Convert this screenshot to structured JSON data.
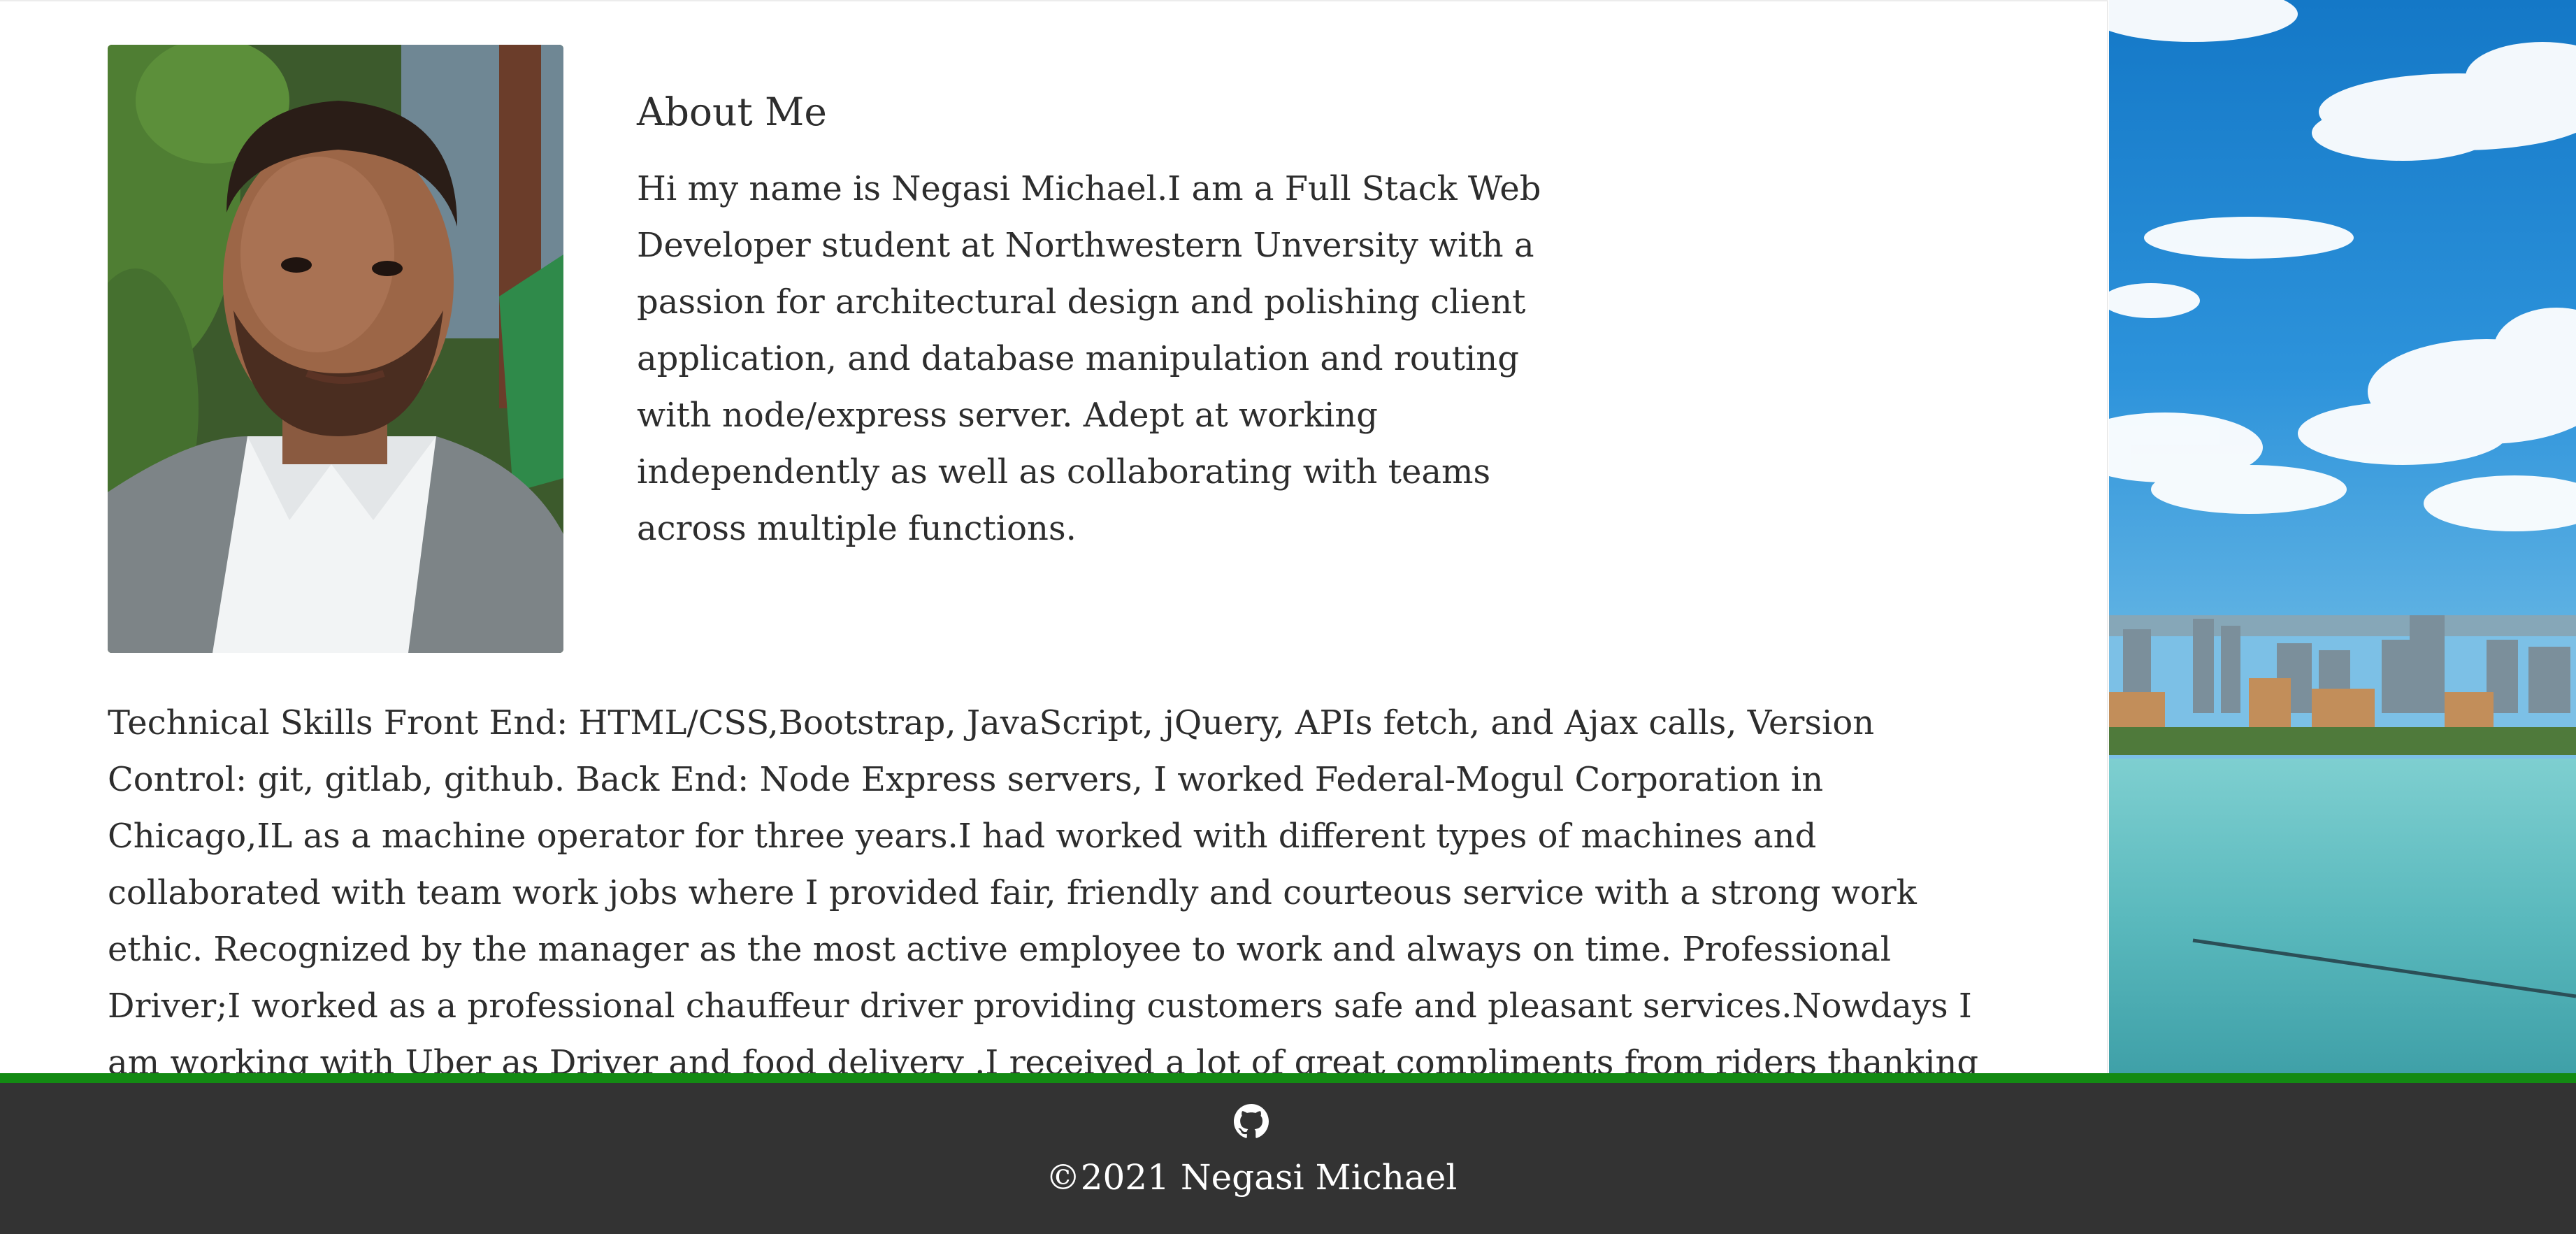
{
  "about": {
    "title": "About Me",
    "body": "Hi my name is Negasi Michael.I am a Full Stack Web Developer student at Northwestern Unversity with a passion for architectural design and polishing client application, and database manipulation and routing with node/express server. Adept at working independently as well as collaborating with teams across multiple functions."
  },
  "skills": {
    "body": "Technical Skills Front End: HTML/CSS,Bootstrap, JavaScript, jQuery, APIs fetch, and Ajax calls, Version Control: git, gitlab, github. Back End: Node Express servers, I worked Federal-Mogul Corporation in Chicago,IL as a machine operator for three years.I had worked with different types of machines and collaborated with team work jobs where I provided fair, friendly and courteous service with a strong work ethic. Recognized by the manager as the most active employee to work and always on time. Professional Driver;I worked as a professional chauffeur driver providing customers safe and pleasant services.Nowdays I am working with Uber as Driver and food delivery .I received a lot of great compliments from riders thanking me for the experience of a safe, on-time"
  },
  "footer": {
    "github_icon": "github-icon",
    "copyright": "©2021 Negasi Michael"
  },
  "colors": {
    "footer_bg": "#333333",
    "footer_accent": "#138a13",
    "text": "#2d2d2d"
  }
}
